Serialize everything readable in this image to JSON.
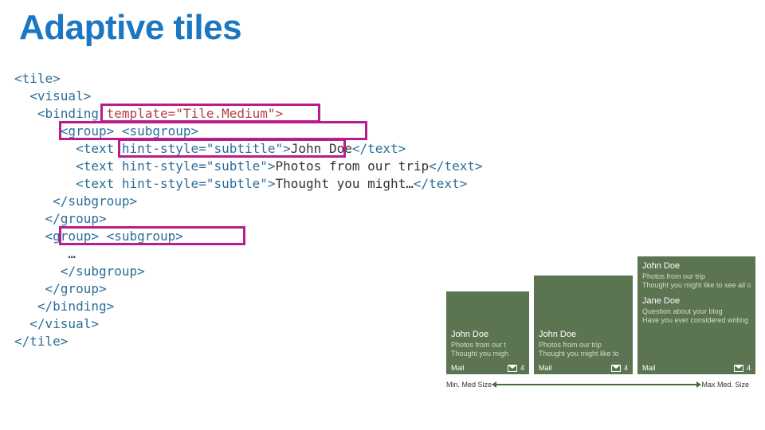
{
  "title": "Adaptive tiles",
  "code": {
    "l1": "<tile>",
    "l2": "  <visual>",
    "l3a": "   <binding",
    "l3b": " template=\"Tile.Medium\">",
    "l4": "      <group> <subgroup>",
    "l5a": "        <text hint-style=\"subtitle\">",
    "l5b": "John Doe",
    "l5c": "</text>",
    "l6a": "        <text hint-style=\"subtle\">",
    "l6b": "Photos from our trip",
    "l6c": "</text>",
    "l7a": "        <text hint-style=\"subtle\">",
    "l7b": "Thought you might…",
    "l7c": "</text>",
    "l8": "     </subgroup>",
    "l9": "    </group>",
    "l10": "    <group> <subgroup>",
    "l11": "       …",
    "l12": "      </subgroup>",
    "l13": "    </group>",
    "l14": "   </binding>",
    "l15": "  </visual>",
    "l16": "</tile>"
  },
  "tiles": {
    "small": {
      "john": "John Doe",
      "l1": "Photos from our t",
      "l2": "Thought you migh",
      "app": "Mail",
      "badge": "4"
    },
    "med": {
      "john": "John Doe",
      "l1": "Photos from our trip",
      "l2": "Thought you might like to",
      "app": "Mail",
      "badge": "4"
    },
    "large": {
      "john": "John Doe",
      "l1": "Photos from our trip",
      "l2": "Thought you might like to see all o",
      "jane": "Jane Doe",
      "l3": "Question about your blog",
      "l4": "Have you ever considered writing a",
      "app": "Mail",
      "badge": "4"
    }
  },
  "labels": {
    "min": "Min. Med Size",
    "max": "Max Med. Size"
  }
}
